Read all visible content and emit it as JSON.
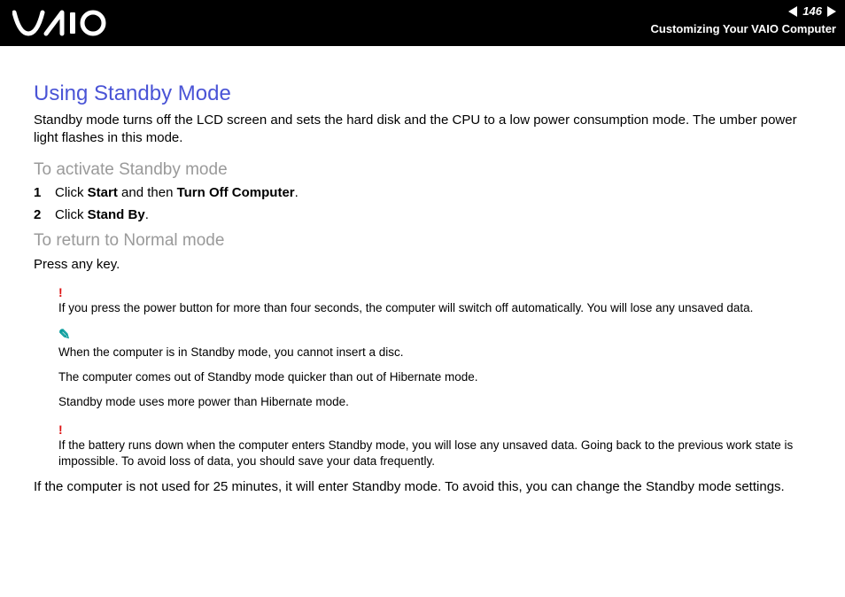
{
  "header": {
    "page_number": "146",
    "section_title": "Customizing Your VAIO Computer"
  },
  "title": "Using Standby Mode",
  "intro": "Standby mode turns off the LCD screen and sets the hard disk and the CPU to a low power consumption mode. The umber power light flashes in this mode.",
  "activate": {
    "heading": "To activate Standby mode",
    "steps": [
      {
        "n": "1",
        "pre": "Click ",
        "b1": "Start",
        "mid": " and then ",
        "b2": "Turn Off Computer",
        "post": "."
      },
      {
        "n": "2",
        "pre": "Click ",
        "b1": "Stand By",
        "mid": "",
        "b2": "",
        "post": "."
      }
    ]
  },
  "return": {
    "heading": "To return to Normal mode",
    "text": "Press any key."
  },
  "notes": {
    "warn1": "If you press the power button for more than four seconds, the computer will switch off automatically. You will lose any unsaved data.",
    "info1": "When the computer is in Standby mode, you cannot insert a disc.",
    "info2": "The computer comes out of Standby mode quicker than out of Hibernate mode.",
    "info3": "Standby mode uses more power than Hibernate mode.",
    "warn2": "If the battery runs down when the computer enters Standby mode, you will lose any unsaved data. Going back to the previous work state is impossible. To avoid loss of data, you should save your data frequently."
  },
  "final": "If the computer is not used for 25 minutes, it will enter Standby mode. To avoid this, you can change the Standby mode settings."
}
